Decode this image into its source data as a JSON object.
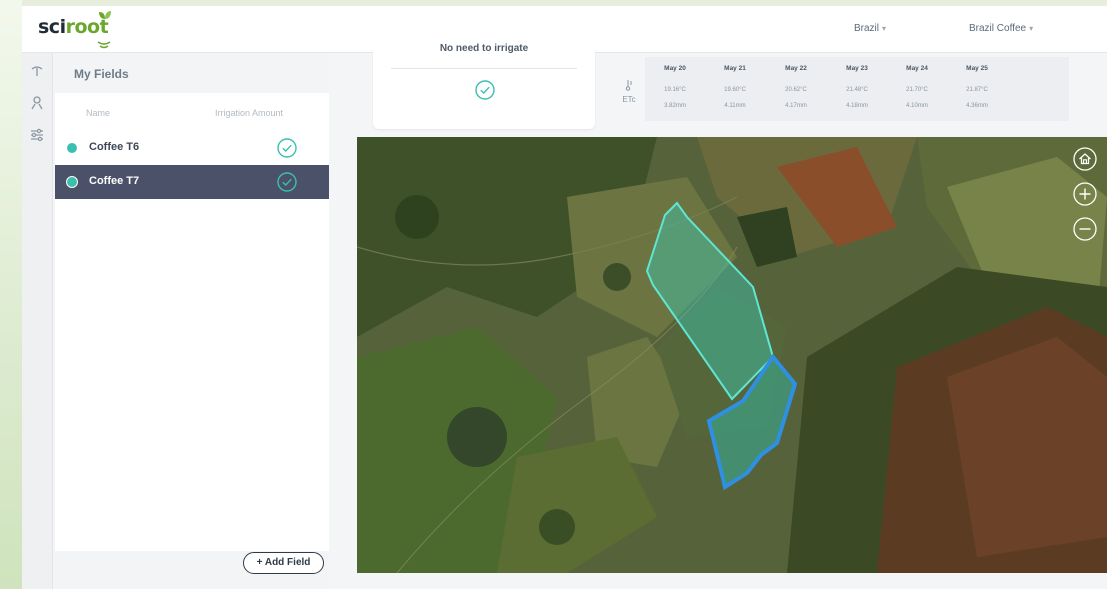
{
  "brand": {
    "logo_part1": "sci",
    "logo_part2": "root"
  },
  "topbar": {
    "region": "Brazil",
    "farm": "Brazil Coffee"
  },
  "rail": {
    "icons": [
      "sprinkler-icon",
      "user-icon",
      "sliders-icon"
    ]
  },
  "fields": {
    "title": "My Fields",
    "columns": {
      "name": "Name",
      "irrigation": "Irrigation Amount"
    },
    "rows": [
      {
        "name": "Coffee T6",
        "status": "check",
        "color": "#3bbfb0",
        "selected": false
      },
      {
        "name": "Coffee T7",
        "status": "check",
        "color": "#3bbfb0",
        "selected": true
      }
    ],
    "add_button": "+ Add Field"
  },
  "irrigation_card": {
    "status": "No need to irrigate",
    "icon": "check-circle-icon"
  },
  "et": {
    "row_labels": {
      "temp_icon": "thermometer-icon",
      "etc": "ETc"
    },
    "days": [
      {
        "date": "May 20",
        "temp": "19.16°C",
        "etc": "3.82mm"
      },
      {
        "date": "May 21",
        "temp": "19.60°C",
        "etc": "4.11mm"
      },
      {
        "date": "May 22",
        "temp": "20.62°C",
        "etc": "4.17mm"
      },
      {
        "date": "May 23",
        "temp": "21.48°C",
        "etc": "4.18mm"
      },
      {
        "date": "May 24",
        "temp": "21.70°C",
        "etc": "4.10mm"
      },
      {
        "date": "May 25",
        "temp": "21.87°C",
        "etc": "4.36mm"
      }
    ]
  },
  "map": {
    "controls": [
      "home-icon",
      "zoom-in-icon",
      "zoom-out-icon"
    ],
    "field_t6_color": "#3ec9b5",
    "field_t7_color": "#2f8fe0"
  }
}
